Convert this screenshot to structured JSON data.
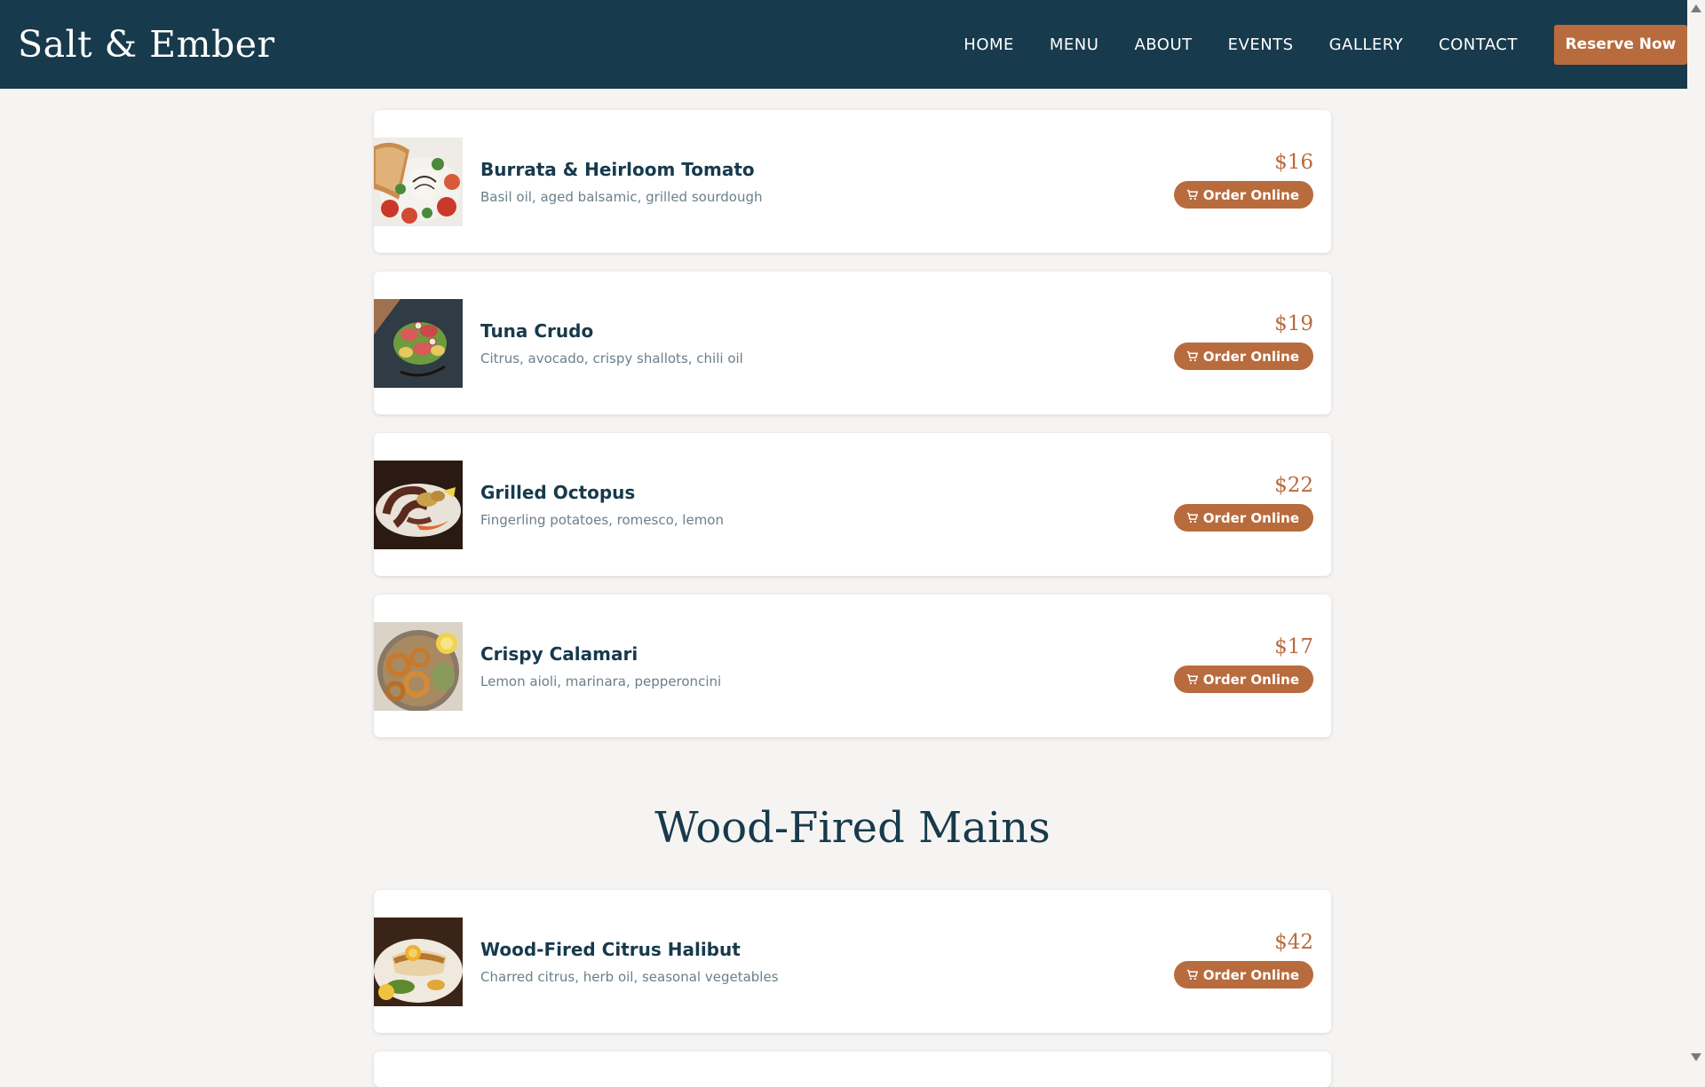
{
  "brand": "Salt & Ember",
  "nav": {
    "links": [
      "HOME",
      "MENU",
      "ABOUT",
      "EVENTS",
      "GALLERY",
      "CONTACT"
    ],
    "reserve_label": "Reserve Now"
  },
  "colors": {
    "nav_bg": "#173a4c",
    "accent": "#b86b3d",
    "page_bg": "#f6f4f2"
  },
  "starters": [
    {
      "name": "Burrata & Heirloom Tomato",
      "description": "Basil oil, aged balsamic, grilled sourdough",
      "price": "$16",
      "order_label": "Order Online",
      "image": "burrata-plate"
    },
    {
      "name": "Tuna Crudo",
      "description": "Citrus, avocado, crispy shallots, chili oil",
      "price": "$19",
      "order_label": "Order Online",
      "image": "tuna-crudo-plate"
    },
    {
      "name": "Grilled Octopus",
      "description": "Fingerling potatoes, romesco, lemon",
      "price": "$22",
      "order_label": "Order Online",
      "image": "octopus-plate"
    },
    {
      "name": "Crispy Calamari",
      "description": "Lemon aioli, marinara, pepperoncini",
      "price": "$17",
      "order_label": "Order Online",
      "image": "calamari-bowl"
    }
  ],
  "mains_section": {
    "title": "Wood-Fired Mains",
    "items": [
      {
        "name": "Wood-Fired Citrus Halibut",
        "description": "Charred citrus, herb oil, seasonal vegetables",
        "price": "$42",
        "order_label": "Order Online",
        "image": "halibut-plate"
      }
    ]
  }
}
